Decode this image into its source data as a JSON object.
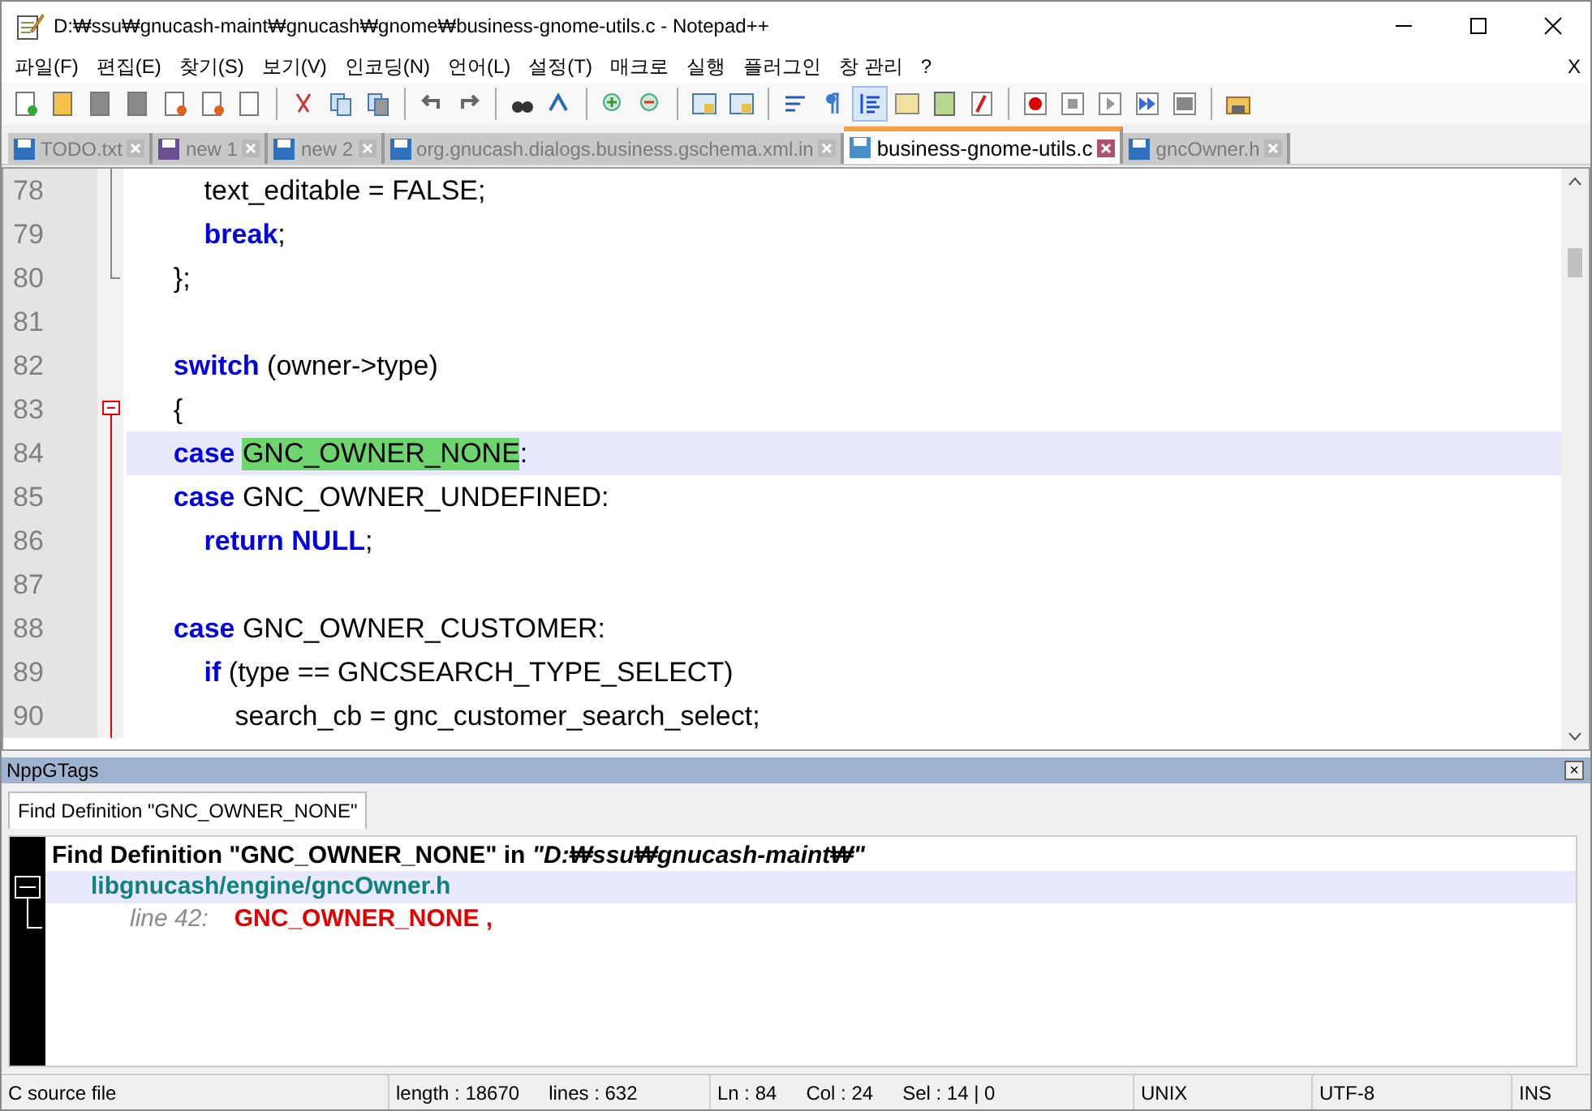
{
  "window": {
    "title": "D:₩ssu₩gnucash-maint₩gnucash₩gnome₩business-gnome-utils.c - Notepad++"
  },
  "menu": [
    "파일(F)",
    "편집(E)",
    "찾기(S)",
    "보기(V)",
    "인코딩(N)",
    "언어(L)",
    "설정(T)",
    "매크로",
    "실행",
    "플러그인",
    "창 관리",
    "?"
  ],
  "menu_close": "X",
  "toolbar": [
    [
      {
        "pressed": false
      },
      {
        "pressed": false
      },
      {
        "pressed": false
      },
      {
        "pressed": false
      },
      {
        "pressed": false
      },
      {
        "pressed": false
      },
      {
        "pressed": false
      }
    ],
    [
      {
        "pressed": false
      },
      {
        "pressed": false
      },
      {
        "pressed": false
      }
    ],
    [
      {
        "pressed": false
      },
      {
        "pressed": false
      }
    ],
    [
      {
        "pressed": false
      },
      {
        "pressed": false
      }
    ],
    [
      {
        "pressed": false
      },
      {
        "pressed": false
      }
    ],
    [
      {
        "pressed": false
      },
      {
        "pressed": false
      }
    ],
    [
      {
        "pressed": false
      },
      {
        "pressed": false
      },
      {
        "pressed": true
      },
      {
        "pressed": false
      },
      {
        "pressed": false
      },
      {
        "pressed": false
      }
    ],
    [
      {
        "pressed": false
      },
      {
        "pressed": false
      },
      {
        "pressed": false
      },
      {
        "pressed": false
      },
      {
        "pressed": false
      }
    ],
    [
      {
        "pressed": false
      }
    ]
  ],
  "tabs": [
    {
      "label": "TODO.txt",
      "selected": false,
      "color": "#2f6fc0"
    },
    {
      "label": "new 1",
      "selected": false,
      "color": "#6a4f8f"
    },
    {
      "label": "new 2",
      "selected": false,
      "color": "#2f6fc0"
    },
    {
      "label": "org.gnucash.dialogs.business.gschema.xml.in",
      "selected": false,
      "color": "#2f6fc0"
    },
    {
      "label": "business-gnome-utils.c",
      "selected": true,
      "color": "#4a90c8"
    },
    {
      "label": "gncOwner.h",
      "selected": false,
      "color": "#2f6fc0"
    }
  ],
  "editor": {
    "lines": [
      {
        "number": "78",
        "selected": false,
        "fold_start": false,
        "fold_end": false,
        "tokens": [
          {
            "kind": "text",
            "text": "\t\ttext_editable = FALSE;"
          }
        ]
      },
      {
        "number": "79",
        "selected": false,
        "fold_start": false,
        "fold_end": false,
        "tokens": [
          {
            "kind": "keyword",
            "text": "\t\tbreak"
          },
          {
            "kind": "text",
            "text": ";"
          }
        ]
      },
      {
        "number": "80",
        "selected": false,
        "fold_start": false,
        "fold_end": true,
        "tokens": [
          {
            "kind": "text",
            "text": "\t};"
          }
        ]
      },
      {
        "number": "81",
        "selected": false,
        "fold_start": false,
        "fold_end": false
      },
      {
        "number": "82",
        "selected": false,
        "fold_start": false,
        "fold_end": false,
        "tokens": [
          {
            "kind": "keyword",
            "text": "\tswitch"
          },
          {
            "kind": "text",
            "text": " (owner->type)"
          }
        ]
      },
      {
        "number": "83",
        "selected": false,
        "fold_start": true,
        "fold_end": false,
        "tokens": [
          {
            "kind": "text",
            "text": "\t{"
          }
        ]
      },
      {
        "number": "84",
        "selected": true,
        "fold_start": false,
        "fold_end": false,
        "tokens": [
          {
            "kind": "keyword",
            "text": "\tcase "
          },
          {
            "kind": "match",
            "text": "GNC_OWNER_NONE"
          },
          {
            "kind": "text",
            "text": ":"
          }
        ]
      },
      {
        "number": "85",
        "selected": false,
        "fold_start": false,
        "fold_end": false,
        "tokens": [
          {
            "kind": "keyword",
            "text": "\tcase"
          },
          {
            "kind": "text",
            "text": " GNC_OWNER_UNDEFINED:"
          }
        ]
      },
      {
        "number": "86",
        "selected": false,
        "fold_start": false,
        "fold_end": false,
        "tokens": [
          {
            "kind": "keyword",
            "text": "\t\treturn NULL"
          },
          {
            "kind": "text",
            "text": ";"
          }
        ]
      },
      {
        "number": "87",
        "selected": false,
        "fold_start": false,
        "fold_end": false
      },
      {
        "number": "88",
        "selected": false,
        "fold_start": false,
        "fold_end": false,
        "tokens": [
          {
            "kind": "keyword",
            "text": "\tcase"
          },
          {
            "kind": "text",
            "text": " GNC_OWNER_CUSTOMER:"
          }
        ]
      },
      {
        "number": "89",
        "selected": false,
        "fold_start": false,
        "fold_end": false,
        "tokens": [
          {
            "kind": "keyword",
            "text": "\t\tif"
          },
          {
            "kind": "text",
            "text": " (type == GNCSEARCH_TYPE_SELECT)"
          }
        ]
      },
      {
        "number": "90",
        "selected": false,
        "fold_start": false,
        "fold_end": false,
        "tokens": [
          {
            "kind": "text",
            "text": "\t\t\tsearch_cb = gnc_customer_search_select;"
          }
        ]
      }
    ]
  },
  "panel": {
    "title": "NppGTags",
    "close": "×",
    "tab": "Find Definition \"GNC_OWNER_NONE\"",
    "results": {
      "header": "Find Definition \"GNC_OWNER_NONE\" in *\"D:₩ssu₩gnucash-maint₩\"*",
      "files": [
        {
          "path": "libgnucash/engine/gncOwner.h",
          "selected": true,
          "expanded": true,
          "children": [
            {
              "line": "line 42:",
              "match": "GNC_OWNER_NONE ,"
            }
          ]
        }
      ]
    }
  },
  "status_bar": {
    "type": "C source file",
    "length": "length : 18670",
    "lines": "lines : 632",
    "ln": "Ln : 84",
    "col": "Col : 24",
    "sel": "Sel : 14 | 0",
    "eol": "UNIX",
    "encoding": "UTF-8",
    "mode": "INS"
  }
}
